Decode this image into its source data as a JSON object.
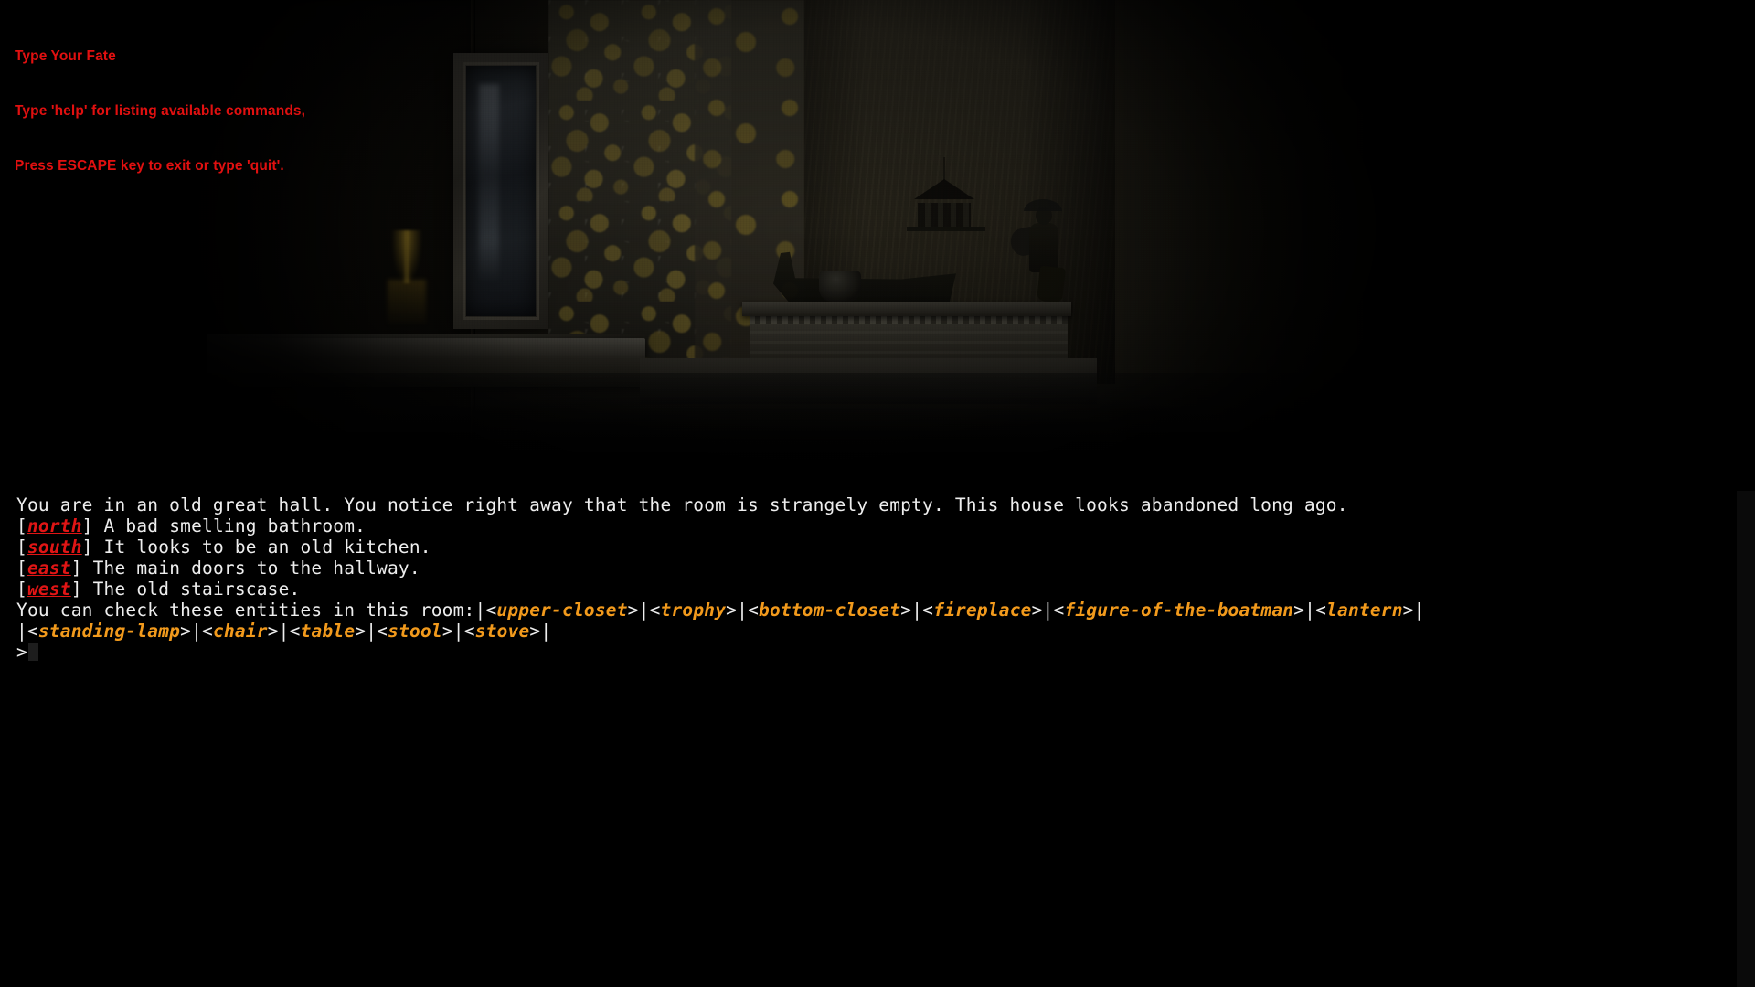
{
  "intro": {
    "title": "Type Your Fate",
    "help_line": "Type 'help' for listing available commands,",
    "exit_line": "Press ESCAPE key to exit or type 'quit'."
  },
  "colors": {
    "intro_red": "#e11010",
    "direction_red": "#e01515",
    "entity_orange": "#f29a1c",
    "body_text": "#eeeeee",
    "console_background": "#000000"
  },
  "console": {
    "room_description": "You are in an old great hall. You notice right away that the room is strangely empty. This house looks abandoned long ago.",
    "exits": [
      {
        "open_bracket": "[",
        "direction": "north",
        "close_bracket": "]",
        "description": " A bad smelling bathroom."
      },
      {
        "open_bracket": "[",
        "direction": "south",
        "close_bracket": "]",
        "description": " It looks to be an old kitchen."
      },
      {
        "open_bracket": "[",
        "direction": "east",
        "close_bracket": "]",
        "description": " The main doors to the hallway."
      },
      {
        "open_bracket": "[",
        "direction": "west",
        "close_bracket": "]",
        "description": " The old stairscase."
      }
    ],
    "entities_label": "You can check these entities in this room:",
    "entities_line_1": [
      "upper-closet",
      "trophy",
      "bottom-closet",
      "fireplace",
      "figure-of-the-boatman",
      "lantern"
    ],
    "entities_line_2": [
      "standing-lamp",
      "chair",
      "table",
      "stool",
      "stove"
    ],
    "separator": "|",
    "bracket_open": "<",
    "bracket_close": ">",
    "prompt_symbol": ">",
    "prompt_value": ""
  },
  "scene": {
    "alt": "dark abandoned great hall with gold floral wallpaper, tall mirror, hanging lantern, boatman figurine on a mantelpiece"
  }
}
